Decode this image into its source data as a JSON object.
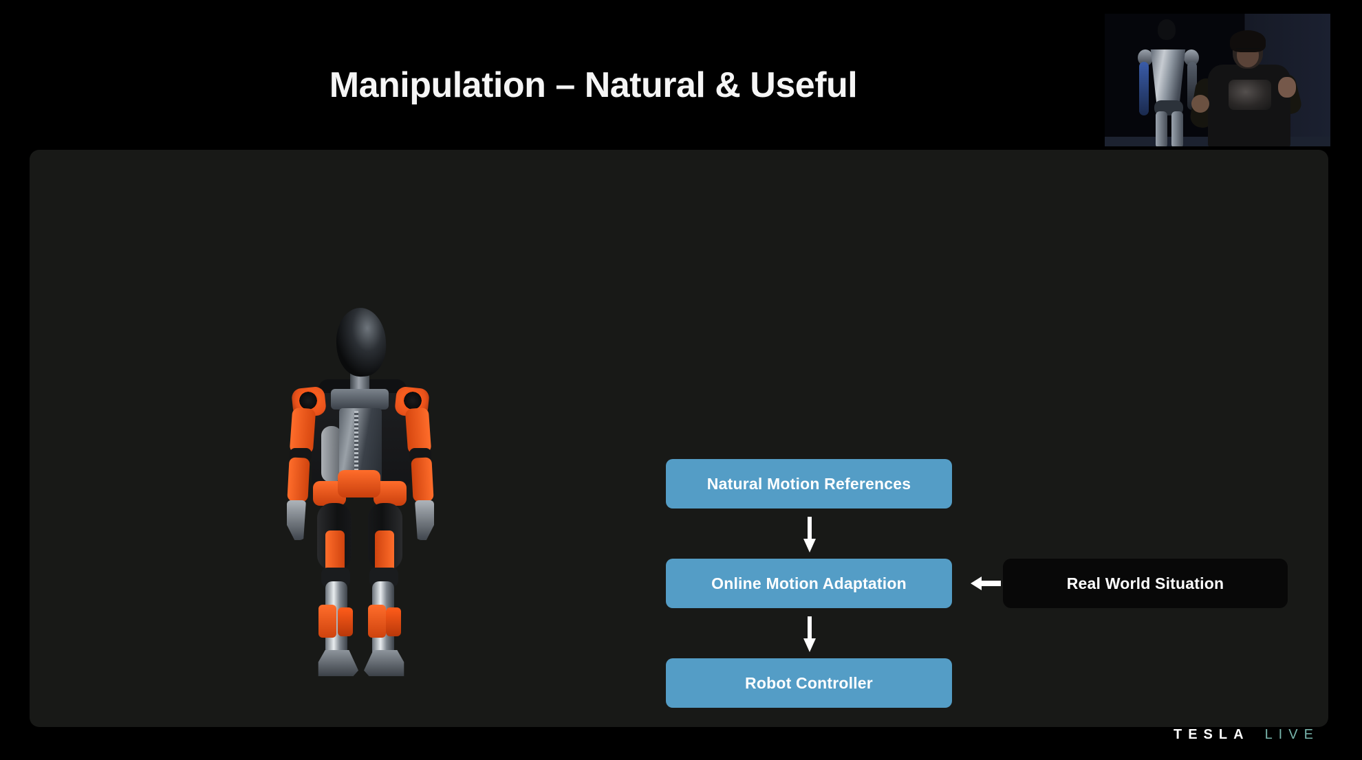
{
  "slide": {
    "title": "Manipulation – Natural & Useful",
    "panel_bg": "#181917",
    "page_bg": "#000000"
  },
  "diagram": {
    "accent_color": "#549dc6",
    "black_node_color": "#080808",
    "nodes": [
      {
        "id": "natural-motion-references",
        "label": "Natural Motion References",
        "style": "blue"
      },
      {
        "id": "online-motion-adaptation",
        "label": "Online Motion Adaptation",
        "style": "blue"
      },
      {
        "id": "robot-controller",
        "label": "Robot Controller",
        "style": "blue"
      },
      {
        "id": "real-world-situation",
        "label": "Real World Situation",
        "style": "black"
      }
    ],
    "arrows": [
      {
        "id": "arrow-1",
        "direction": "down",
        "from": "natural-motion-references",
        "to": "online-motion-adaptation"
      },
      {
        "id": "arrow-2",
        "direction": "down",
        "from": "online-motion-adaptation",
        "to": "robot-controller"
      },
      {
        "id": "arrow-3",
        "direction": "left",
        "from": "real-world-situation",
        "to": "online-motion-adaptation"
      }
    ]
  },
  "robot": {
    "name": "humanoid-robot-front-view",
    "accent_color": "#ff6d2b"
  },
  "pip": {
    "name": "live-presentation-video",
    "subjects": [
      "presenter",
      "humanoid-robot"
    ]
  },
  "branding": {
    "tesla": "TESLA",
    "live": "LIVE",
    "tesla_color": "#ffffff",
    "live_color": "#79b6ad"
  }
}
